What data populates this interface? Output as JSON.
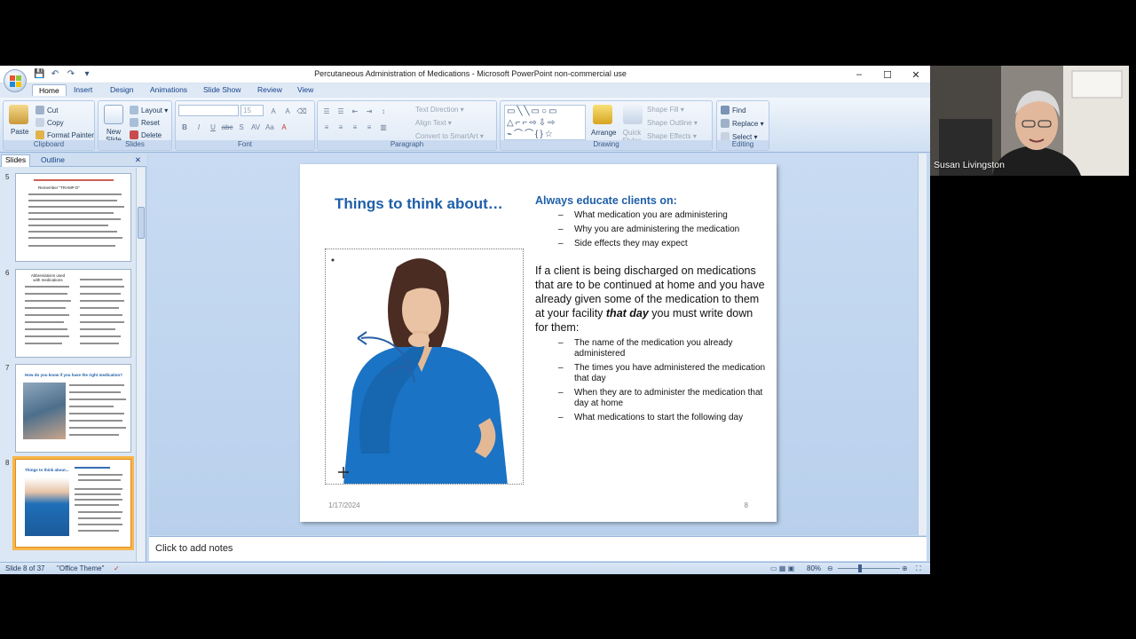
{
  "window": {
    "title": "Percutaneous Administration of Medications - Microsoft PowerPoint non-commercial use",
    "controls": [
      "–",
      "☐",
      "✕"
    ]
  },
  "qat": [
    "💾",
    "↶",
    "↷",
    "▾"
  ],
  "tabs": [
    "Home",
    "Insert",
    "Design",
    "Animations",
    "Slide Show",
    "Review",
    "View"
  ],
  "ribbon": {
    "clipboard": {
      "label": "Clipboard",
      "paste": "Paste",
      "cut": "Cut",
      "copy": "Copy",
      "format_painter": "Format Painter"
    },
    "slides": {
      "label": "Slides",
      "new_slide": "New Slide ▾",
      "layout": "Layout ▾",
      "reset": "Reset",
      "delete": "Delete"
    },
    "font": {
      "label": "Font",
      "size": "15"
    },
    "paragraph": {
      "label": "Paragraph",
      "text_direction": "Text Direction ▾",
      "align_text": "Align Text ▾",
      "convert_smartart": "Convert to SmartArt ▾"
    },
    "drawing": {
      "label": "Drawing",
      "arrange": "Arrange",
      "quick_styles": "Quick Styles ▾",
      "shape_fill": "Shape Fill ▾",
      "shape_outline": "Shape Outline ▾",
      "shape_effects": "Shape Effects ▾"
    },
    "editing": {
      "label": "Editing",
      "find": "Find",
      "replace": "Replace ▾",
      "select": "Select ▾"
    }
  },
  "pane_tabs": {
    "slides": "Slides",
    "outline": "Outline"
  },
  "thumbnails": [
    {
      "num": "5",
      "title": "Remember \"TRAMP D\""
    },
    {
      "num": "6",
      "title": "Abbreviations used with medications"
    },
    {
      "num": "7",
      "title": "How do you know if you have the right medication?"
    },
    {
      "num": "8",
      "title": "Things to think about..."
    }
  ],
  "slide": {
    "title": "Things to think about…",
    "subhead": "Always educate clients on:",
    "educate_items": [
      "What medication you are administering",
      "Why you are administering the medication",
      "Side effects they may expect"
    ],
    "para_before": "If a client is being discharged on medications that are to be continued at home and you have already given some of the medication to them at your facility ",
    "para_emph": "that day",
    "para_after": " you must write down for them:",
    "writedown_items": [
      "The name of the medication you already administered",
      "The times you have administered the medication that day",
      "When they are to administer the medication that day at home",
      "What medications to start the following day"
    ],
    "date": "1/17/2024",
    "number": "8"
  },
  "notes_placeholder": "Click to add notes",
  "status": {
    "slide_pos": "Slide 8 of 37",
    "theme": "\"Office Theme\"",
    "zoom": "80%"
  },
  "webcam": {
    "name": "Susan Livingston"
  }
}
